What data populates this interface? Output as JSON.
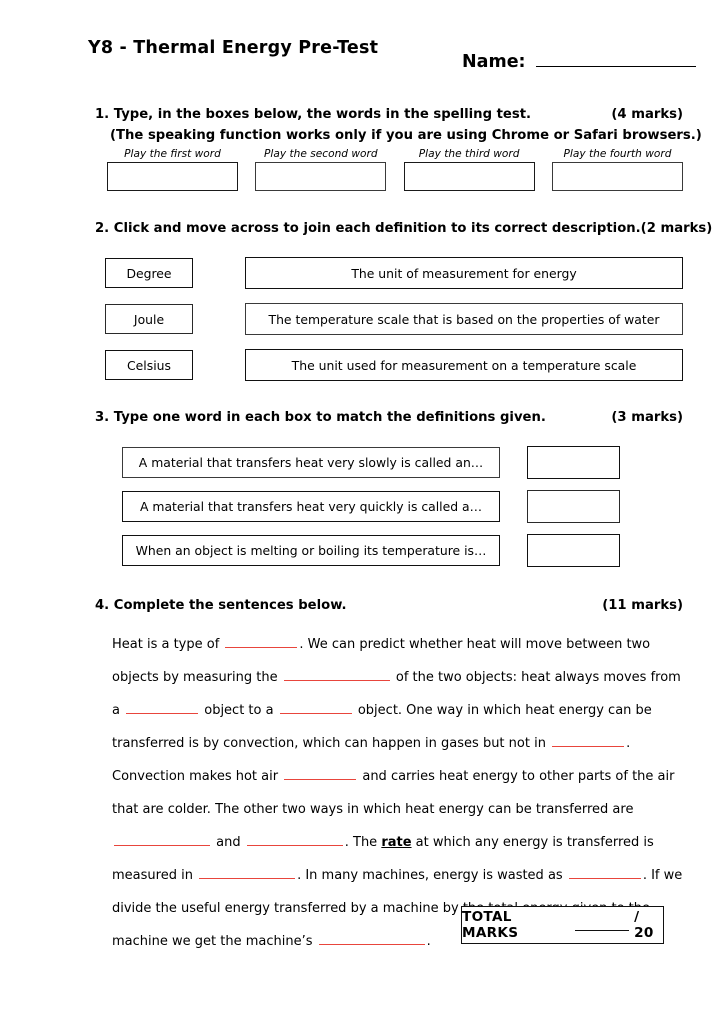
{
  "document": {
    "title": "Y8 - Thermal Energy Pre-Test",
    "name_label": "Name:"
  },
  "questions": [
    {
      "number": "1. Type, in the boxes below, the words in the spelling test.",
      "marks": "(4 marks)",
      "note": "(The speaking function works only if you are using Chrome or Safari browsers.)",
      "play_labels": [
        "Play the first word",
        "Play the second word",
        "Play the third word",
        "Play the fourth word"
      ],
      "answers": [
        "",
        "",
        "",
        ""
      ]
    },
    {
      "number": "2. Click and move across to join each definition to its correct description.",
      "marks": "(2 marks)",
      "terms": [
        "Degree",
        "Joule",
        "Celsius"
      ],
      "descriptions": [
        "The unit of measurement for energy",
        "The temperature scale that is based on the properties of water",
        "The unit used for measurement on a temperature scale"
      ]
    },
    {
      "number": "3. Type one word in each box to match the definitions given.",
      "marks": "(3 marks)",
      "definitions": [
        "A material that transfers heat very slowly is called an…",
        "A material that transfers heat very quickly is called a…",
        "When an object is melting or boiling its temperature is…"
      ],
      "answers": [
        "",
        "",
        ""
      ]
    },
    {
      "number": "4. Complete the sentences below.",
      "marks": "(11 marks)",
      "paragraph": {
        "t1": "Heat is a type of ",
        "t2": ". We can predict whether heat will move between two objects by measuring the ",
        "t3": " of the two objects: heat always moves from a ",
        "t4": " object to a ",
        "t5": " object. One way in which heat energy can be transferred is by convection, which can happen in gases but not in ",
        "t6": ". Convection makes hot air ",
        "t7": " and carries heat energy to other parts of the air that are colder. The other two ways in which heat energy can be transferred are ",
        "t8": " and ",
        "t9": ". The ",
        "emphasis": "rate",
        "t10": " at which any energy is transferred is measured in ",
        "t11": ". In many machines, energy is wasted as ",
        "t12": ". If we divide the useful energy transferred by a machine by the total energy given to the machine we get the machine’s ",
        "t13": "."
      }
    }
  ],
  "footer": {
    "total_label": "TOTAL MARKS",
    "total_value": "",
    "total_out_of": "/ 20"
  },
  "colors": {
    "blank_underline": "#e8453c",
    "border": "#111111",
    "background": "#ffffff"
  }
}
